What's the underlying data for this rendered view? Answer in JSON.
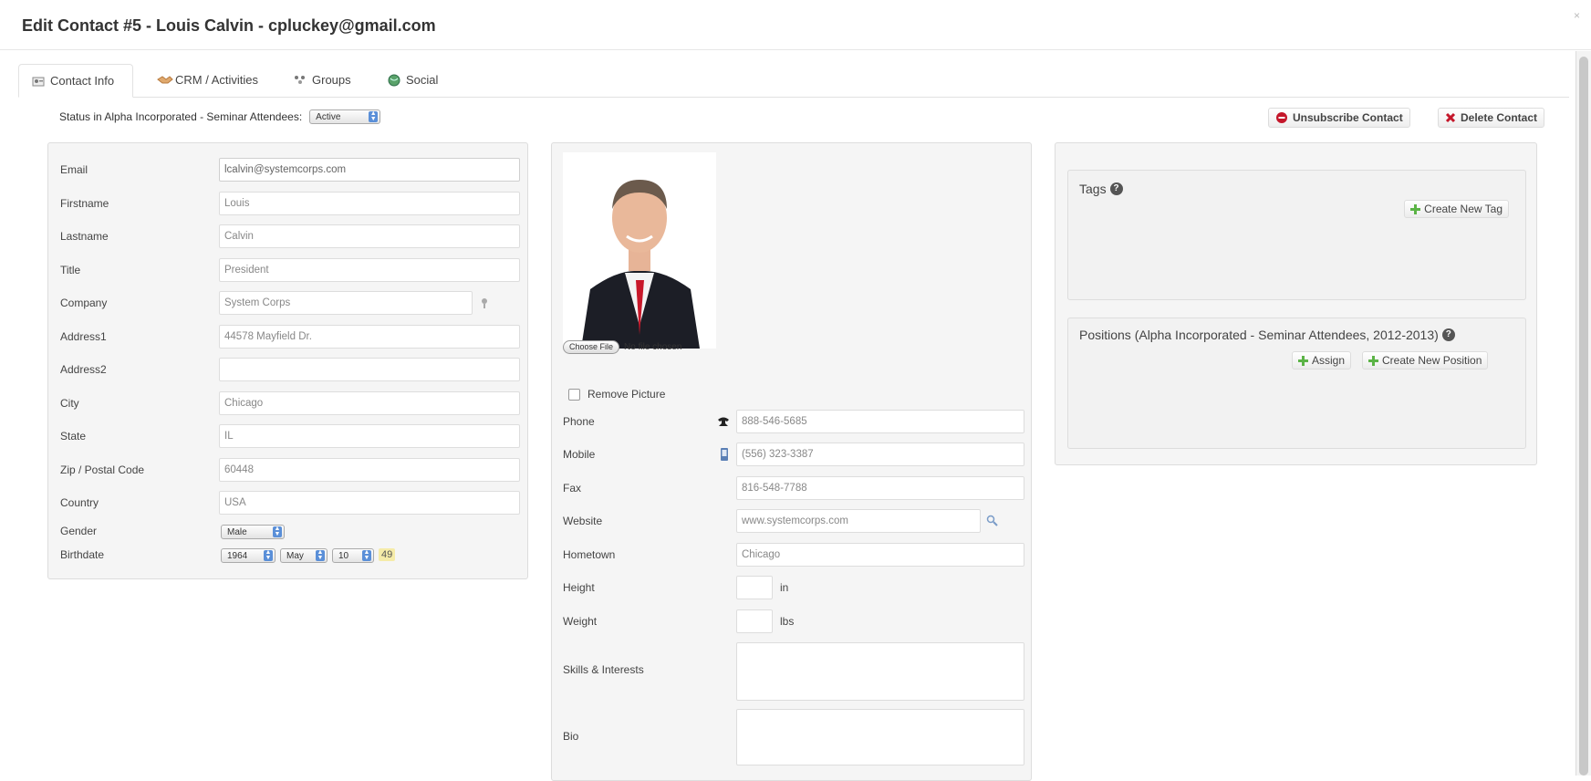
{
  "window": {
    "title": "Edit Contact #5 - Louis Calvin - cpluckey@gmail.com",
    "close_glyph": "×"
  },
  "tabs": [
    {
      "label": "Contact Info",
      "icon": "contact-card-icon"
    },
    {
      "label": "CRM / Activities",
      "icon": "handshake-icon"
    },
    {
      "label": "Groups",
      "icon": "groups-icon"
    },
    {
      "label": "Social",
      "icon": "globe-icon"
    }
  ],
  "status": {
    "label": "Status in Alpha Incorporated - Seminar Attendees:",
    "value": "Active"
  },
  "actions": {
    "unsubscribe": "Unsubscribe Contact",
    "delete": "Delete Contact"
  },
  "contact_form": {
    "email": {
      "label": "Email",
      "value": "lcalvin@systemcorps.com"
    },
    "firstname": {
      "label": "Firstname",
      "value": "Louis"
    },
    "lastname": {
      "label": "Lastname",
      "value": "Calvin"
    },
    "title": {
      "label": "Title",
      "value": "President"
    },
    "company": {
      "label": "Company",
      "value": "System Corps"
    },
    "address1": {
      "label": "Address1",
      "value": "44578 Mayfield Dr."
    },
    "address2": {
      "label": "Address2",
      "value": ""
    },
    "city": {
      "label": "City",
      "value": "Chicago"
    },
    "state": {
      "label": "State",
      "value": "IL"
    },
    "zip": {
      "label": "Zip / Postal Code",
      "value": "60448"
    },
    "country": {
      "label": "Country",
      "value": "USA"
    },
    "gender": {
      "label": "Gender",
      "value": "Male"
    },
    "birthdate": {
      "label": "Birthdate",
      "year": "1964",
      "month": "May",
      "day": "10",
      "age": "49"
    }
  },
  "picture": {
    "choose_file": "Choose File",
    "no_file": "No file chosen",
    "remove_label": "Remove Picture"
  },
  "details_form": {
    "phone": {
      "label": "Phone",
      "value": "888-546-5685"
    },
    "mobile": {
      "label": "Mobile",
      "value": "(556) 323-3387"
    },
    "fax": {
      "label": "Fax",
      "value": "816-548-7788"
    },
    "website": {
      "label": "Website",
      "value": "www.systemcorps.com"
    },
    "hometown": {
      "label": "Hometown",
      "value": "Chicago"
    },
    "height": {
      "label": "Height",
      "unit": "in",
      "value": ""
    },
    "weight": {
      "label": "Weight",
      "unit": "lbs",
      "value": ""
    },
    "skills": {
      "label": "Skills & Interests"
    },
    "bio": {
      "label": "Bio"
    }
  },
  "tags": {
    "title": "Tags",
    "create_button": "Create New Tag"
  },
  "positions": {
    "title": "Positions (Alpha Incorporated - Seminar Attendees, 2012-2013)",
    "assign_button": "Assign",
    "create_button": "Create New Position"
  },
  "colors": {
    "accent_blue": "#5a8fd8",
    "add_green": "#5bb346",
    "danger_red": "#c4162a",
    "panel_bg": "#f5f5f5"
  }
}
